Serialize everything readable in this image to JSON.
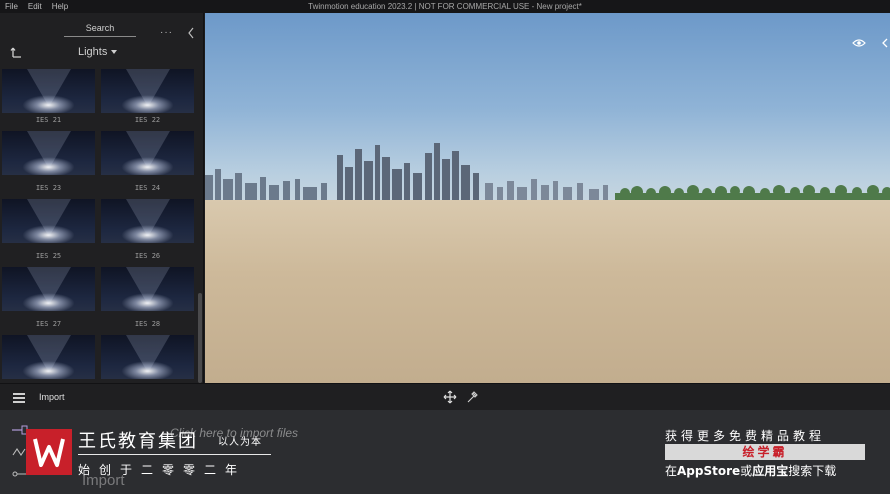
{
  "menubar": {
    "items": [
      "File",
      "Edit",
      "Help"
    ],
    "title": "Twinmotion education 2023.2 | NOT FOR COMMERCIAL USE - New project*"
  },
  "library": {
    "search_label": "Search",
    "category": "Lights",
    "items": [
      {
        "label": "IES 21"
      },
      {
        "label": "IES 22"
      },
      {
        "label": "IES 23"
      },
      {
        "label": "IES 24"
      },
      {
        "label": "IES 25"
      },
      {
        "label": "IES 26"
      },
      {
        "label": "IES 27"
      },
      {
        "label": "IES 28"
      },
      {
        "label": ""
      },
      {
        "label": ""
      }
    ]
  },
  "bottom_bar": {
    "import_label": "Import"
  },
  "drop_area": {
    "hint": "Click here to import files",
    "import_label": "Import"
  },
  "watermark": {
    "name": "王氏教育集团",
    "motto": "以人为本",
    "founded": "始创于二零零二年",
    "promo_line1": "获得更多免费精品教程",
    "promo_app": "绘学霸",
    "promo_line3_prefix": "在",
    "promo_store1": "AppStore",
    "promo_or": "或",
    "promo_store2": "应用宝",
    "promo_suffix": "搜索下载",
    "brand_color": "#c8202a"
  },
  "icons": {
    "back": "back-arrow-icon",
    "more": "more-dots-icon",
    "collapse": "collapse-panel-icon",
    "eye": "eye-icon",
    "move": "move-gizmo-icon",
    "eyedropper": "eyedropper-icon"
  }
}
